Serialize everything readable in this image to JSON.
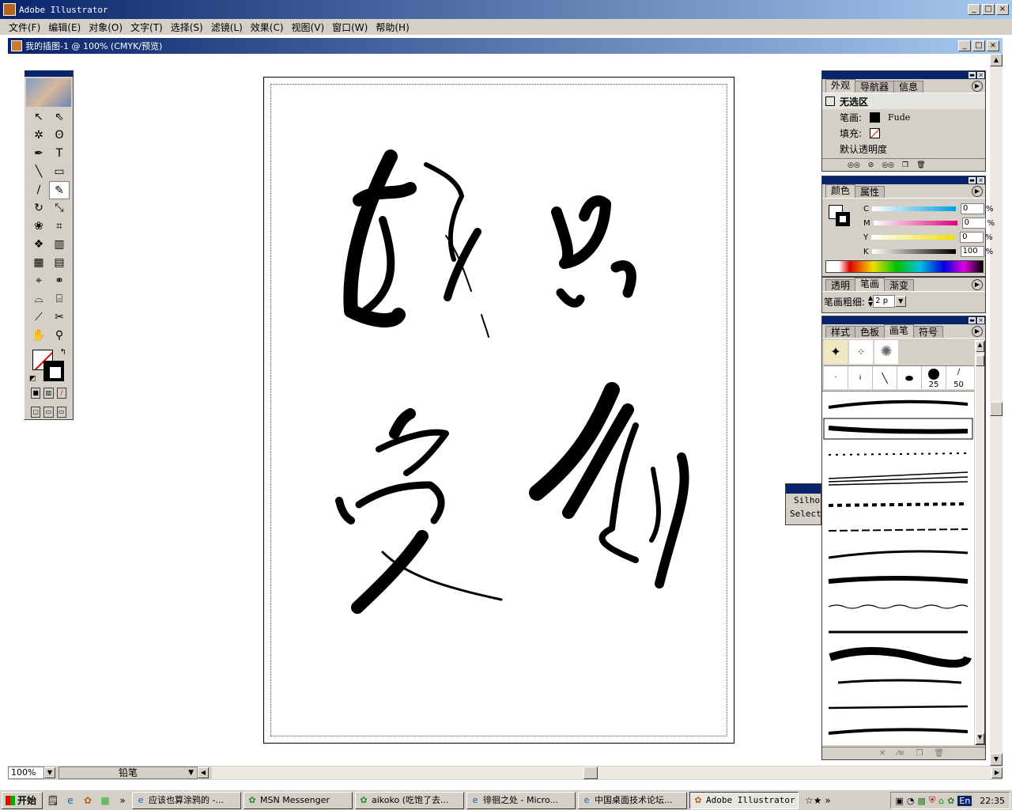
{
  "app": {
    "title": "Adobe Illustrator"
  },
  "menu": [
    "文件(F)",
    "编辑(E)",
    "对象(O)",
    "文字(T)",
    "选择(S)",
    "滤镜(L)",
    "效果(C)",
    "视图(V)",
    "窗口(W)",
    "帮助(H)"
  ],
  "document": {
    "title": "我的插图-1 @ 100% (CMYK/预览)"
  },
  "status": {
    "zoom": "100%",
    "tool": "铅笔"
  },
  "appearance_palette": {
    "tabs": [
      "外观",
      "导航器",
      "信息"
    ],
    "selection": "无选区",
    "stroke_label": "笔画:",
    "stroke_value": "Fude",
    "fill_label": "填充:",
    "opacity_label": "默认透明度"
  },
  "color_palette": {
    "tabs": [
      "颜色",
      "属性"
    ],
    "channels": [
      {
        "label": "C",
        "value": "0"
      },
      {
        "label": "M",
        "value": "0"
      },
      {
        "label": "Y",
        "value": "0"
      },
      {
        "label": "K",
        "value": "100"
      }
    ],
    "unit": "%"
  },
  "stroke_palette": {
    "tabs": [
      "透明",
      "笔画",
      "渐变"
    ],
    "weight_label": "笔画粗细:",
    "weight_value": "2 p"
  },
  "brush_palette": {
    "tabs": [
      "样式",
      "色板",
      "画笔",
      "符号"
    ],
    "size_labels": [
      "25",
      "50"
    ]
  },
  "floating_palette": {
    "line1": "Silho",
    "line2": "Select"
  },
  "taskbar": {
    "start": "开始",
    "tasks": [
      {
        "label": "应该也算涂鸦的 -..."
      },
      {
        "label": "MSN Messenger"
      },
      {
        "label": "aikoko (吃饱了去..."
      },
      {
        "label": "徘徊之处 - Micro..."
      },
      {
        "label": "中国桌面技术论坛..."
      },
      {
        "label": "Adobe Illustrator"
      }
    ],
    "lang": "En",
    "clock": "22:35"
  },
  "colors": {
    "title_bar": "#0a246a",
    "face": "#d4d0c8",
    "ink": "#000000"
  }
}
